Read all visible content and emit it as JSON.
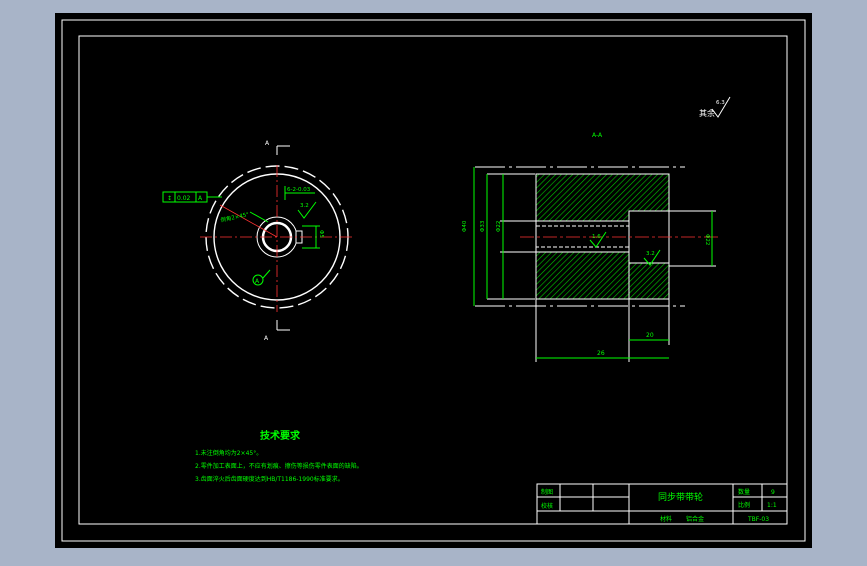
{
  "colors": {
    "background": "#a8b4c8",
    "paper": "#000000",
    "frame": "#ffffff",
    "text": "#00ff00",
    "hatch": "#00ff00",
    "centerline": "#ff3333",
    "annotation": "#00ffff"
  },
  "drawing": {
    "section_label_top": "A",
    "section_label_bottom": "A",
    "section_view_label": "A-A",
    "roughness_note": "其余",
    "roughness_value": "6.3",
    "tolerance_frame": [
      "↕",
      "0.02",
      "A"
    ],
    "datum_label": "A",
    "keyway_tolerance": "6-2-0.03",
    "bore_roughness": "3.2",
    "chamfer_note": "倒角2×45°",
    "bore_dim": "Φ5",
    "left_dims": [
      "Φ40",
      "Φ33",
      "Φ22"
    ],
    "right_dim": "Φ22",
    "bore_roughness_2": "1.6",
    "hub_roughness": "3.2",
    "dim_hub_length": "20",
    "dim_total_length": "26"
  },
  "notes": {
    "heading": "技术要求",
    "items": [
      "1.未注倒角均为2×45°。",
      "2.零件加工表面上，不应有划痕、擦伤等损伤零件表面的缺陷。",
      "3.齿面淬火后齿面硬度达到HB/T1186-1990标准要求。"
    ]
  },
  "title_block": {
    "drawn_label": "制图",
    "checked_label": "校核",
    "part_name": "同步带带轮",
    "qty_label": "数量",
    "qty_value": "9",
    "scale_label": "比例",
    "scale_value": "1:1",
    "material_label": "材料",
    "material_value": "铝合金",
    "drawing_no": "TBF-03"
  }
}
